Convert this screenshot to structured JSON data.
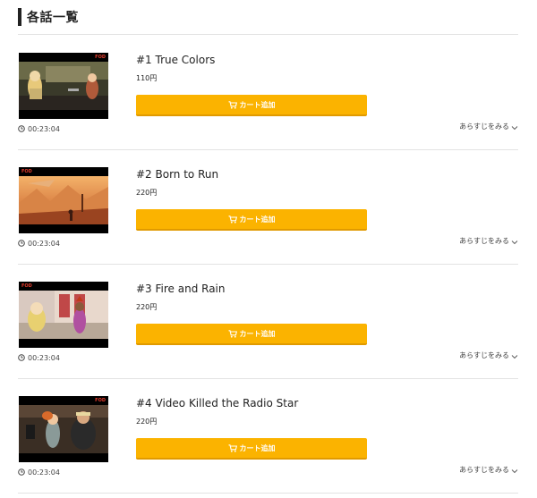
{
  "section": {
    "title": "各話一覧"
  },
  "labels": {
    "cart_button": "カート追加",
    "synopsis": "あらすじをみる",
    "channel_logo": "FOD"
  },
  "colors": {
    "cart_button": "#fbb300",
    "divider": "#e3e3e3"
  },
  "icons": {
    "duration": "clock-icon",
    "cart": "cart-icon",
    "synopsis": "chevron-down-icon"
  },
  "episodes": [
    {
      "title": "#1 True Colors",
      "price": "110円",
      "duration": "00:23:04"
    },
    {
      "title": "#2 Born to Run",
      "price": "220円",
      "duration": "00:23:04"
    },
    {
      "title": "#3 Fire and Rain",
      "price": "220円",
      "duration": "00:23:04"
    },
    {
      "title": "#4 Video Killed the Radio Star",
      "price": "220円",
      "duration": "00:23:04"
    }
  ]
}
